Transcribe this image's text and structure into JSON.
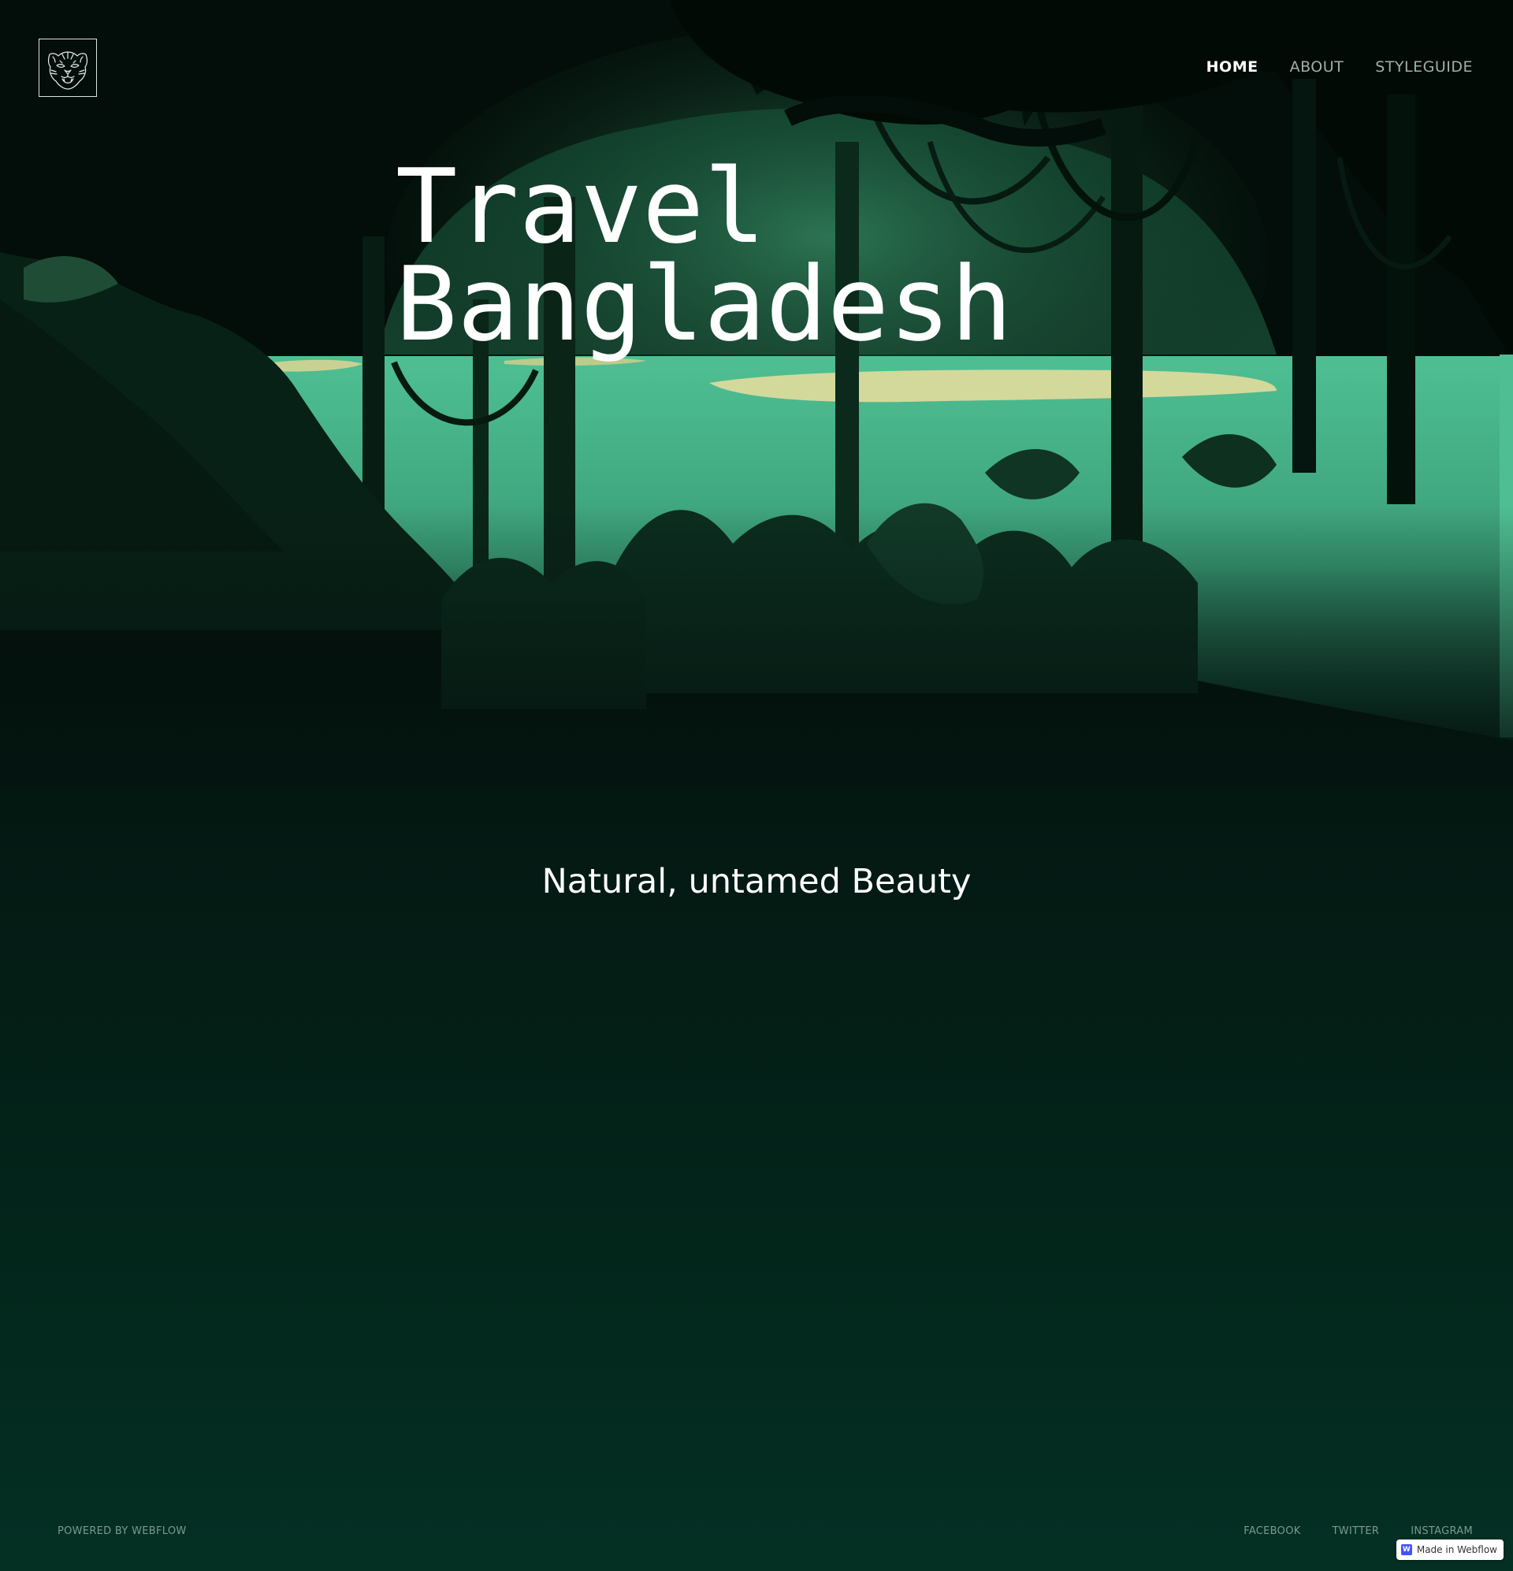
{
  "corner_label": "",
  "nav": {
    "items": [
      {
        "label": "HOME"
      },
      {
        "label": "ABOUT"
      },
      {
        "label": "STYLEGUIDE"
      }
    ]
  },
  "hero": {
    "title_line1": "Travel",
    "title_line2": "Bangladesh"
  },
  "tagline": "Natural, untamed Beauty",
  "footer": {
    "powered": "POWERED BY WEBFLOW",
    "social": [
      {
        "label": "FACEBOOK"
      },
      {
        "label": "TWITTER"
      },
      {
        "label": "INSTAGRAM"
      }
    ],
    "badge_text": "Made in Webflow",
    "badge_logo": "W"
  },
  "icons": {
    "logo": "tiger-head-icon",
    "badge": "webflow-logo-icon"
  },
  "colors": {
    "background_top": "#030d09",
    "background_bottom": "#043024",
    "river": "#4fbf93",
    "sand": "#d3d99a",
    "nav_inactive": "#9db1a8",
    "footer_text": "#7c9a8e"
  }
}
